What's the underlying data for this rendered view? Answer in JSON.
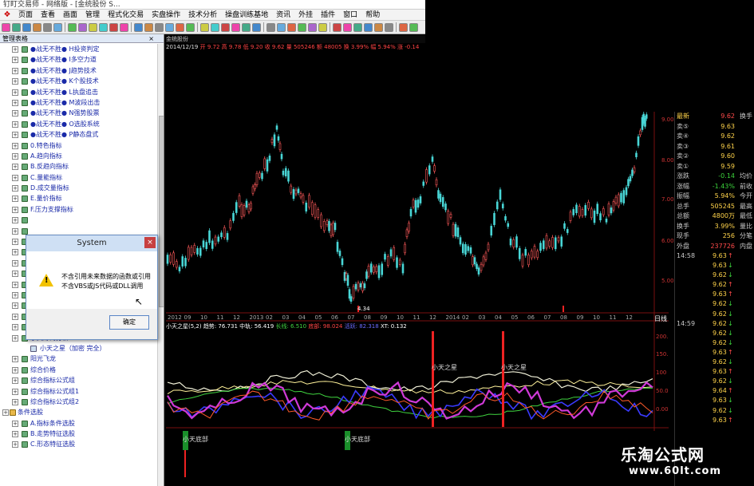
{
  "window": {
    "title": "钉盯交易师 - 网络版 - [金统股份 S..."
  },
  "menu": [
    "页面",
    "查看",
    "画面",
    "管理",
    "程式化交易",
    "实盘操作",
    "技术分析",
    "操盘训练基地",
    "资讯",
    "外挂",
    "插件",
    "窗口",
    "帮助"
  ],
  "side_panel": {
    "title": "管理表格",
    "close": "×"
  },
  "tree": [
    {
      "label": "●战无不胜● H投资判定",
      "level": 1
    },
    {
      "label": "●战无不胜● I多空力道",
      "level": 1
    },
    {
      "label": "●战无不胜● J趋势技术",
      "level": 1
    },
    {
      "label": "●战无不胜● K个股技术",
      "level": 1
    },
    {
      "label": "●战无不胜● L执盘追击",
      "level": 1
    },
    {
      "label": "●战无不胜● M波段出击",
      "level": 1
    },
    {
      "label": "●战无不胜● N强势股票",
      "level": 1
    },
    {
      "label": "●战无不胜● O选股系统",
      "level": 1
    },
    {
      "label": "●战无不胜● P静态盘式",
      "level": 1
    },
    {
      "label": "0.特色指标",
      "level": 1
    },
    {
      "label": "A.趋向指标",
      "level": 1
    },
    {
      "label": "B.反趋向指标",
      "level": 1
    },
    {
      "label": "C.量能指标",
      "level": 1
    },
    {
      "label": "D.成交量指标",
      "level": 1
    },
    {
      "label": "E.量价指标",
      "level": 1
    },
    {
      "label": "F.压力支撑指标",
      "level": 1
    },
    {
      "label": "",
      "level": 1
    },
    {
      "label": "",
      "level": 1
    },
    {
      "label": "",
      "level": 1
    },
    {
      "label": "",
      "level": 1
    },
    {
      "label": "",
      "level": 1
    },
    {
      "label": "",
      "level": 1
    },
    {
      "label": "",
      "level": 1
    },
    {
      "label": "",
      "level": 1
    },
    {
      "label": "",
      "level": 1
    },
    {
      "label": "",
      "level": 1
    },
    {
      "label": "",
      "level": 1
    },
    {
      "label": "小天筹码分析",
      "level": 1
    },
    {
      "label": "小天之星（加密 完全）",
      "level": 2
    },
    {
      "label": "阳光飞龙",
      "level": 1
    },
    {
      "label": "综合价格",
      "level": 1
    },
    {
      "label": "综合指标公式组",
      "level": 1
    },
    {
      "label": "综合指标公式组1",
      "level": 1
    },
    {
      "label": "综合指标公式组2",
      "level": 1
    },
    {
      "label": "条件选股",
      "level": 0
    },
    {
      "label": "A.指标条件选股",
      "level": 1
    },
    {
      "label": "B.走势特征选股",
      "level": 1
    },
    {
      "label": "C.形态特征选股",
      "level": 1
    }
  ],
  "dialog": {
    "title": "System",
    "close": "×",
    "line1": "不含引用未来数据的函数或引用",
    "line2": "不含VBS或JS代码或DLL调用",
    "ok": "确定"
  },
  "chart": {
    "tab": "金统股份",
    "info_date": "2014/12/19",
    "info_rest": "开 9.72 高 9.78 低 9.20 收 9.62 量 505246 额 48005 换 3.99% 幅 5.94% 涨 -0.14",
    "low_label": "4.34",
    "y_top": [
      "9.00",
      "8.00",
      "7.00",
      "6.00",
      "5.00"
    ],
    "x_labels": [
      "2012",
      "09",
      "10",
      "11",
      "12",
      "2013",
      "02",
      "03",
      "04",
      "05",
      "06",
      "07",
      "08",
      "09",
      "10",
      "11",
      "12",
      "2014",
      "02",
      "03",
      "04",
      "05",
      "06",
      "07",
      "08",
      "09",
      "10",
      "11",
      "12"
    ],
    "period": "日线",
    "ind_name": "小天之星(5,2)",
    "ind_values": [
      {
        "t": "趋势: 76.731",
        "c": "w"
      },
      {
        "t": "中轨: 56.419",
        "c": "w"
      },
      {
        "t": "长线: 6.510",
        "c": "g"
      },
      {
        "t": "底部: 98.024",
        "c": "rr"
      },
      {
        "t": "活跃: 82.318",
        "c": "b"
      },
      {
        "t": "XT: 0.132",
        "c": "w"
      }
    ],
    "y_bot": [
      "200.",
      "150.",
      "100",
      "50.0",
      "0.00"
    ],
    "star_label_1": "小天之星",
    "star_label_2": "小天之星",
    "bottom_label_1": "小天底部",
    "bottom_label_2": "小天底部"
  },
  "quote": {
    "header": {
      "k": "最新",
      "v": "9.62",
      "k2": "换手"
    },
    "rows": [
      {
        "k": "卖⑤",
        "v": "9.63"
      },
      {
        "k": "卖④",
        "v": "9.62"
      },
      {
        "k": "卖③",
        "v": "9.61"
      },
      {
        "k": "卖②",
        "v": "9.60"
      },
      {
        "k": "卖①",
        "v": "9.59"
      },
      {
        "k": "涨跌",
        "v": "-0.14",
        "k2": "均价"
      },
      {
        "k": "涨幅",
        "v": "-1.43%",
        "k2": "前收"
      },
      {
        "k": "振幅",
        "v": "5.94%",
        "k2": "今开"
      },
      {
        "k": "总手",
        "v": "505245",
        "k2": "最高"
      },
      {
        "k": "总额",
        "v": "4800万",
        "k2": "最低"
      },
      {
        "k": "换手",
        "v": "3.99%",
        "k2": "量比"
      },
      {
        "k": "现手",
        "v": "256",
        "k2": "分笔"
      },
      {
        "k": "外盘",
        "v": "237726",
        "k2": "内盘"
      }
    ]
  },
  "ticks": [
    {
      "t": "14:58",
      "p": "9.63",
      "a": "↑"
    },
    {
      "t": "",
      "p": "9.63",
      "a": "↓"
    },
    {
      "t": "",
      "p": "9.62",
      "a": "↓"
    },
    {
      "t": "",
      "p": "9.62",
      "a": "↑"
    },
    {
      "t": "",
      "p": "9.63",
      "a": "↑"
    },
    {
      "t": "",
      "p": "9.62",
      "a": "↓"
    },
    {
      "t": "",
      "p": "9.62",
      "a": "↓"
    },
    {
      "t": "14:59",
      "p": "9.62",
      "a": "↓"
    },
    {
      "t": "",
      "p": "9.62",
      "a": "↓"
    },
    {
      "t": "",
      "p": "9.62",
      "a": "↓"
    },
    {
      "t": "",
      "p": "9.63",
      "a": "↑"
    },
    {
      "t": "",
      "p": "9.62",
      "a": "↓"
    },
    {
      "t": "",
      "p": "9.63",
      "a": "↑"
    },
    {
      "t": "",
      "p": "9.62",
      "a": "↓"
    },
    {
      "t": "",
      "p": "9.64",
      "a": "↑"
    },
    {
      "t": "",
      "p": "9.63",
      "a": "↓"
    },
    {
      "t": "",
      "p": "9.62",
      "a": "↓"
    },
    {
      "t": "",
      "p": "9.63",
      "a": "↑"
    }
  ],
  "watermark": {
    "cn": "乐淘公式网",
    "url": "www.60lt.com"
  }
}
